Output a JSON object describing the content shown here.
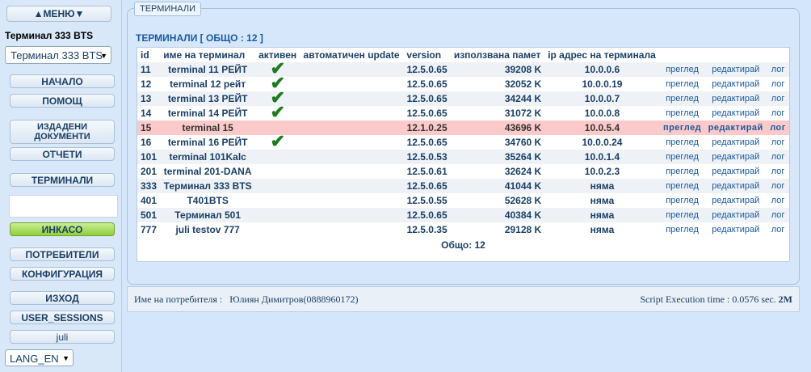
{
  "sidebar": {
    "menu_toggle": "▲МЕНЮ▼",
    "terminal_title": "Терминал 333 BTS",
    "terminal_select": "Терминал 333 BTS",
    "buttons": {
      "home": "НАЧАЛО",
      "help": "ПОМОЩ",
      "issued_docs_1": "ИЗДАДЕНИ",
      "issued_docs_2": "ДОКУМЕНТИ",
      "reports": "ОТЧЕТИ",
      "terminals": "ТЕРМИНАЛИ",
      "inkaso": "ИНКАСО",
      "users": "ПОТРЕБИТЕЛИ",
      "config": "КОНФИГУРАЦИЯ",
      "logout": "ИЗХОД",
      "user_sessions": "USER_SESSIONS",
      "user": "juli"
    },
    "lang_select": "LANG_EN"
  },
  "panel": {
    "tab": "ТЕРМИНАЛИ",
    "caption": "ТЕРМИНАЛИ [ ОБЩО : 12 ]",
    "headers": [
      "id",
      "име на терминал",
      "активен",
      "автоматичен update",
      "version",
      "използвана памет",
      "ip адрес на терминала",
      "",
      "",
      ""
    ],
    "rows": [
      {
        "id": "11",
        "name": "terminal 11 РЕЙТ",
        "active": "✔",
        "version": "12.5.0.65",
        "mem": "39208 K",
        "ip": "10.0.0.6",
        "view": "преглед",
        "edit": "редактирай",
        "log": "лог"
      },
      {
        "id": "12",
        "name": "terminal 12 рейт",
        "active": "✔",
        "version": "12.5.0.65",
        "mem": "32052 K",
        "ip": "10.0.0.19",
        "view": "преглед",
        "edit": "редактирай",
        "log": "лог"
      },
      {
        "id": "13",
        "name": "terminal 13 РЕЙТ",
        "active": "✔",
        "version": "12.5.0.65",
        "mem": "34244 K",
        "ip": "10.0.0.7",
        "view": "преглед",
        "edit": "редактирай",
        "log": "лог"
      },
      {
        "id": "14",
        "name": "terminal 14 РЕЙТ",
        "active": "✔",
        "version": "12.5.0.65",
        "mem": "31072 K",
        "ip": "10.0.0.8",
        "view": "преглед",
        "edit": "редактирай",
        "log": "лог"
      },
      {
        "id": "15",
        "name": "terminal 15",
        "active": "",
        "version": "12.1.0.25",
        "mem": "43696 K",
        "ip": "10.0.5.4",
        "view": "преглед",
        "edit": "редактирай",
        "log": "лог",
        "highlight": true
      },
      {
        "id": "16",
        "name": "terminal 16 РЕЙТ",
        "active": "✔",
        "version": "12.5.0.65",
        "mem": "34760 K",
        "ip": "10.0.0.24",
        "view": "преглед",
        "edit": "редактирай",
        "log": "лог"
      },
      {
        "id": "101",
        "name": "terminal 101Kalc",
        "active": "",
        "version": "12.5.0.53",
        "mem": "35264 K",
        "ip": "10.0.1.4",
        "view": "преглед",
        "edit": "редактирай",
        "log": "лог"
      },
      {
        "id": "201",
        "name": "terminal 201-DANA",
        "active": "",
        "version": "12.5.0.61",
        "mem": "32624 K",
        "ip": "10.0.2.3",
        "view": "преглед",
        "edit": "редактирай",
        "log": "лог"
      },
      {
        "id": "333",
        "name": "Терминал 333 BTS",
        "active": "",
        "version": "12.5.0.65",
        "mem": "41044 K",
        "ip": "няма",
        "view": "преглед",
        "edit": "редактирай",
        "log": "лог"
      },
      {
        "id": "401",
        "name": "T401BTS",
        "active": "",
        "version": "12.5.0.55",
        "mem": "52628 K",
        "ip": "няма",
        "view": "преглед",
        "edit": "редактирай",
        "log": "лог"
      },
      {
        "id": "501",
        "name": "Терминал 501",
        "active": "",
        "version": "12.5.0.65",
        "mem": "40384 K",
        "ip": "няма",
        "view": "преглед",
        "edit": "редактирай",
        "log": "лог"
      },
      {
        "id": "777",
        "name": "juli testov 777",
        "active": "",
        "version": "12.5.0.35",
        "mem": "29128 K",
        "ip": "няма",
        "view": "преглед",
        "edit": "редактирай",
        "log": "лог"
      }
    ],
    "total": "Общо: 12"
  },
  "footer": {
    "user_label": "Име на потребителя :",
    "user_value": "Юлиян Димитров(0888960172)",
    "exec_time": "Script Execution time : 0.0576 sec.",
    "memory": "2M"
  },
  "colors": {
    "accent": "#1a5aa0",
    "highlight_row": "#fccaca",
    "check": "#1e7a1e",
    "inkaso_button": "#8fce3c"
  }
}
